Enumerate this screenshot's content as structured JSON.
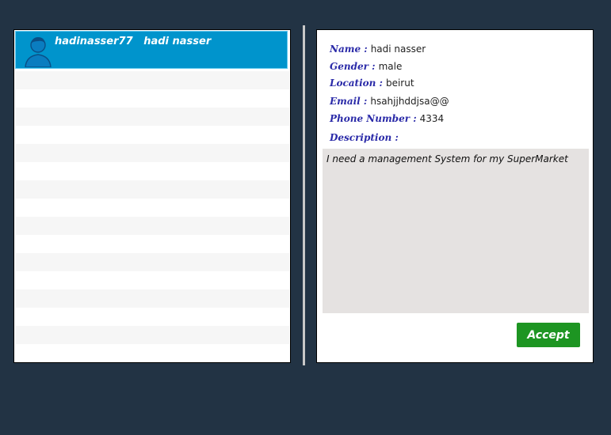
{
  "user_list": {
    "selected_user": {
      "username": "hadinasser77",
      "full_name": "hadi nasser"
    },
    "stripe_rows": 16
  },
  "details": {
    "name_label": "Name :",
    "name_value": "hadi nasser",
    "gender_label": "Gender :",
    "gender_value": "male",
    "location_label": "Location :",
    "location_value": "beirut",
    "email_label": "Email :",
    "email_value": "hsahjjhddjsa@@",
    "phone_label": "Phone Number :",
    "phone_value": "4334",
    "description_label": "Description :",
    "description_value": "I need a management System for my SuperMarket",
    "accept_label": "Accept"
  },
  "colors": {
    "background": "#223344",
    "selected_row": "#0094cc",
    "label": "#2a2aa8",
    "accept_button": "#1d9522",
    "description_bg": "#e5e2e1"
  }
}
